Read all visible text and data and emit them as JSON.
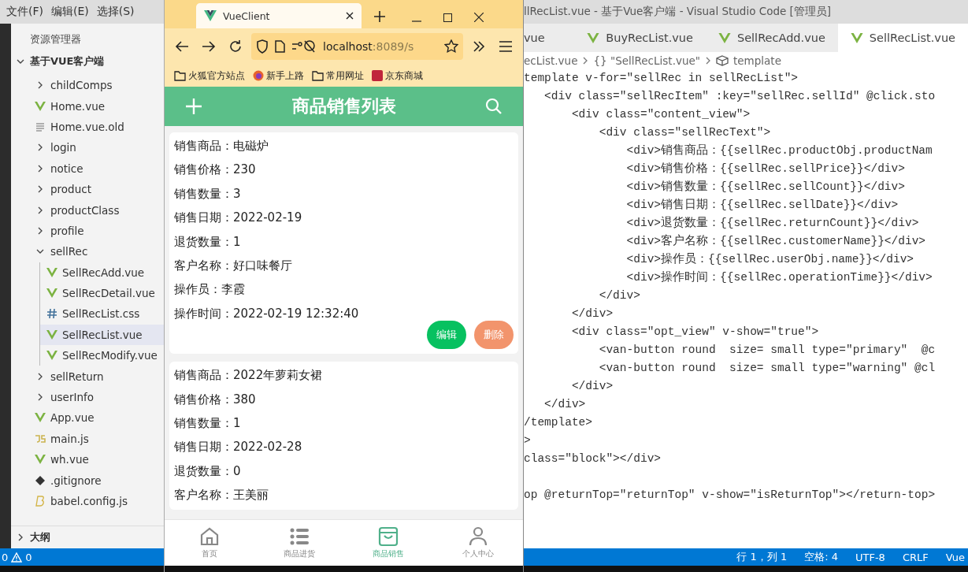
{
  "left_editor": {
    "menu": [
      "文件(F)",
      "编辑(E)",
      "选择(S)"
    ],
    "explorer_title": "资源管理器",
    "project": {
      "name": "基于VUE客户端",
      "expanded": true
    },
    "tree": [
      {
        "name": "childComps",
        "kind": "folder",
        "expanded": false,
        "selected": false
      },
      {
        "name": "Home.vue",
        "kind": "vue",
        "selected": false
      },
      {
        "name": "Home.vue.old",
        "kind": "text",
        "selected": false
      },
      {
        "name": "login",
        "kind": "folder",
        "expanded": false,
        "selected": false
      },
      {
        "name": "notice",
        "kind": "folder",
        "expanded": false,
        "selected": false
      },
      {
        "name": "product",
        "kind": "folder",
        "expanded": false,
        "selected": false
      },
      {
        "name": "productClass",
        "kind": "folder",
        "expanded": false,
        "selected": false
      },
      {
        "name": "profile",
        "kind": "folder",
        "expanded": false,
        "selected": false
      },
      {
        "name": "sellRec",
        "kind": "folder",
        "expanded": true,
        "selected": false,
        "children": [
          {
            "name": "SellRecAdd.vue",
            "kind": "vue",
            "selected": false
          },
          {
            "name": "SellRecDetail.vue",
            "kind": "vue",
            "selected": false
          },
          {
            "name": "SellRecList.css",
            "kind": "css",
            "selected": false
          },
          {
            "name": "SellRecList.vue",
            "kind": "vue",
            "selected": true
          },
          {
            "name": "SellRecModify.vue",
            "kind": "vue",
            "selected": false
          }
        ]
      },
      {
        "name": "sellReturn",
        "kind": "folder",
        "expanded": false,
        "selected": false
      },
      {
        "name": "userInfo",
        "kind": "folder",
        "expanded": false,
        "selected": false
      },
      {
        "name": "App.vue",
        "kind": "vue",
        "selected": false
      },
      {
        "name": "main.js",
        "kind": "js",
        "selected": false
      },
      {
        "name": "wh.vue",
        "kind": "vue",
        "selected": false
      },
      {
        "name": ".gitignore",
        "kind": "git",
        "selected": false
      },
      {
        "name": "babel.config.js",
        "kind": "babel",
        "selected": false
      }
    ],
    "outline": {
      "label": "大纲",
      "expanded": false
    },
    "status": {
      "errors": "0",
      "warnings": "0"
    }
  },
  "browser": {
    "tab_title": "VueClient",
    "url_host": "localhost",
    "url_rest": ":8089/s",
    "bookmarks": [
      {
        "label": "火狐官方站点",
        "kind": "folder"
      },
      {
        "label": "新手上路",
        "kind": "firefox"
      },
      {
        "label": "常用网址",
        "kind": "folder"
      },
      {
        "label": "京东商城",
        "kind": "jd"
      }
    ],
    "app_title": "商品销售列表",
    "records": [
      {
        "fields": [
          "销售商品：电磁炉",
          "销售价格：230",
          "销售数量：3",
          "销售日期：2022-02-19",
          "退货数量：1",
          "客户名称：好口味餐厅",
          "操作员：李霞",
          "操作时间：2022-02-19 12:32:40"
        ],
        "buttons": [
          {
            "label": "编辑",
            "kind": "primary"
          },
          {
            "label": "删除",
            "kind": "warning"
          }
        ]
      },
      {
        "fields": [
          "销售商品：2022年萝莉女裙",
          "销售价格：380",
          "销售数量：1",
          "销售日期：2022-02-28",
          "退货数量：0",
          "客户名称：王美丽"
        ]
      }
    ],
    "nav": [
      {
        "label": "首页",
        "kind": "home",
        "selected": false
      },
      {
        "label": "商品进货",
        "kind": "list",
        "selected": false
      },
      {
        "label": "商品销售",
        "kind": "bag",
        "selected": true
      },
      {
        "label": "个人中心",
        "kind": "person",
        "selected": false
      }
    ]
  },
  "right_editor": {
    "window_title": "llRecList.vue - 基于Vue客户端 - Visual Studio Code [管理员]",
    "tabs": [
      {
        "label": "vue",
        "selected": false,
        "icon": false
      },
      {
        "label": "BuyRecList.vue",
        "selected": false,
        "icon": true
      },
      {
        "label": "SellRecAdd.vue",
        "selected": false,
        "icon": true
      },
      {
        "label": "SellRecList.vue",
        "selected": true,
        "icon": true
      }
    ],
    "breadcrumb": [
      "ecList.vue",
      "{} \"SellRecList.vue\"",
      "template"
    ],
    "code_lines": [
      "template v-for=\"sellRec in sellRecList\">",
      "   <div class=\"sellRecItem\" :key=\"sellRec.sellId\" @click.sto",
      "       <div class=\"content_view\">",
      "           <div class=\"sellRecText\">",
      "               <div>销售商品：{{sellRec.productObj.productNam",
      "               <div>销售价格：{{sellRec.sellPrice}}</div>",
      "               <div>销售数量：{{sellRec.sellCount}}</div>",
      "               <div>销售日期：{{sellRec.sellDate}}</div>",
      "               <div>退货数量：{{sellRec.returnCount}}</div>",
      "               <div>客户名称：{{sellRec.customerName}}</div>",
      "               <div>操作员：{{sellRec.userObj.name}}</div>",
      "               <div>操作时间：{{sellRec.operationTime}}</div>",
      "           </div>",
      "       </div>",
      "       <div class=\"opt_view\" v-show=\"true\">",
      "           <van-button round  size= small type=\"primary\"  @c",
      "           <van-button round  size= small type=\"warning\" @cl",
      "       </div>",
      "   </div>",
      "/template>",
      ">",
      "class=\"block\"></div>",
      "op @returnTop=\"returnTop\" v-show=\"isReturnTop\"></return-top>"
    ],
    "status": [
      "行 1，列 1",
      "空格: 4",
      "UTF-8",
      "CRLF",
      "Vue"
    ]
  }
}
